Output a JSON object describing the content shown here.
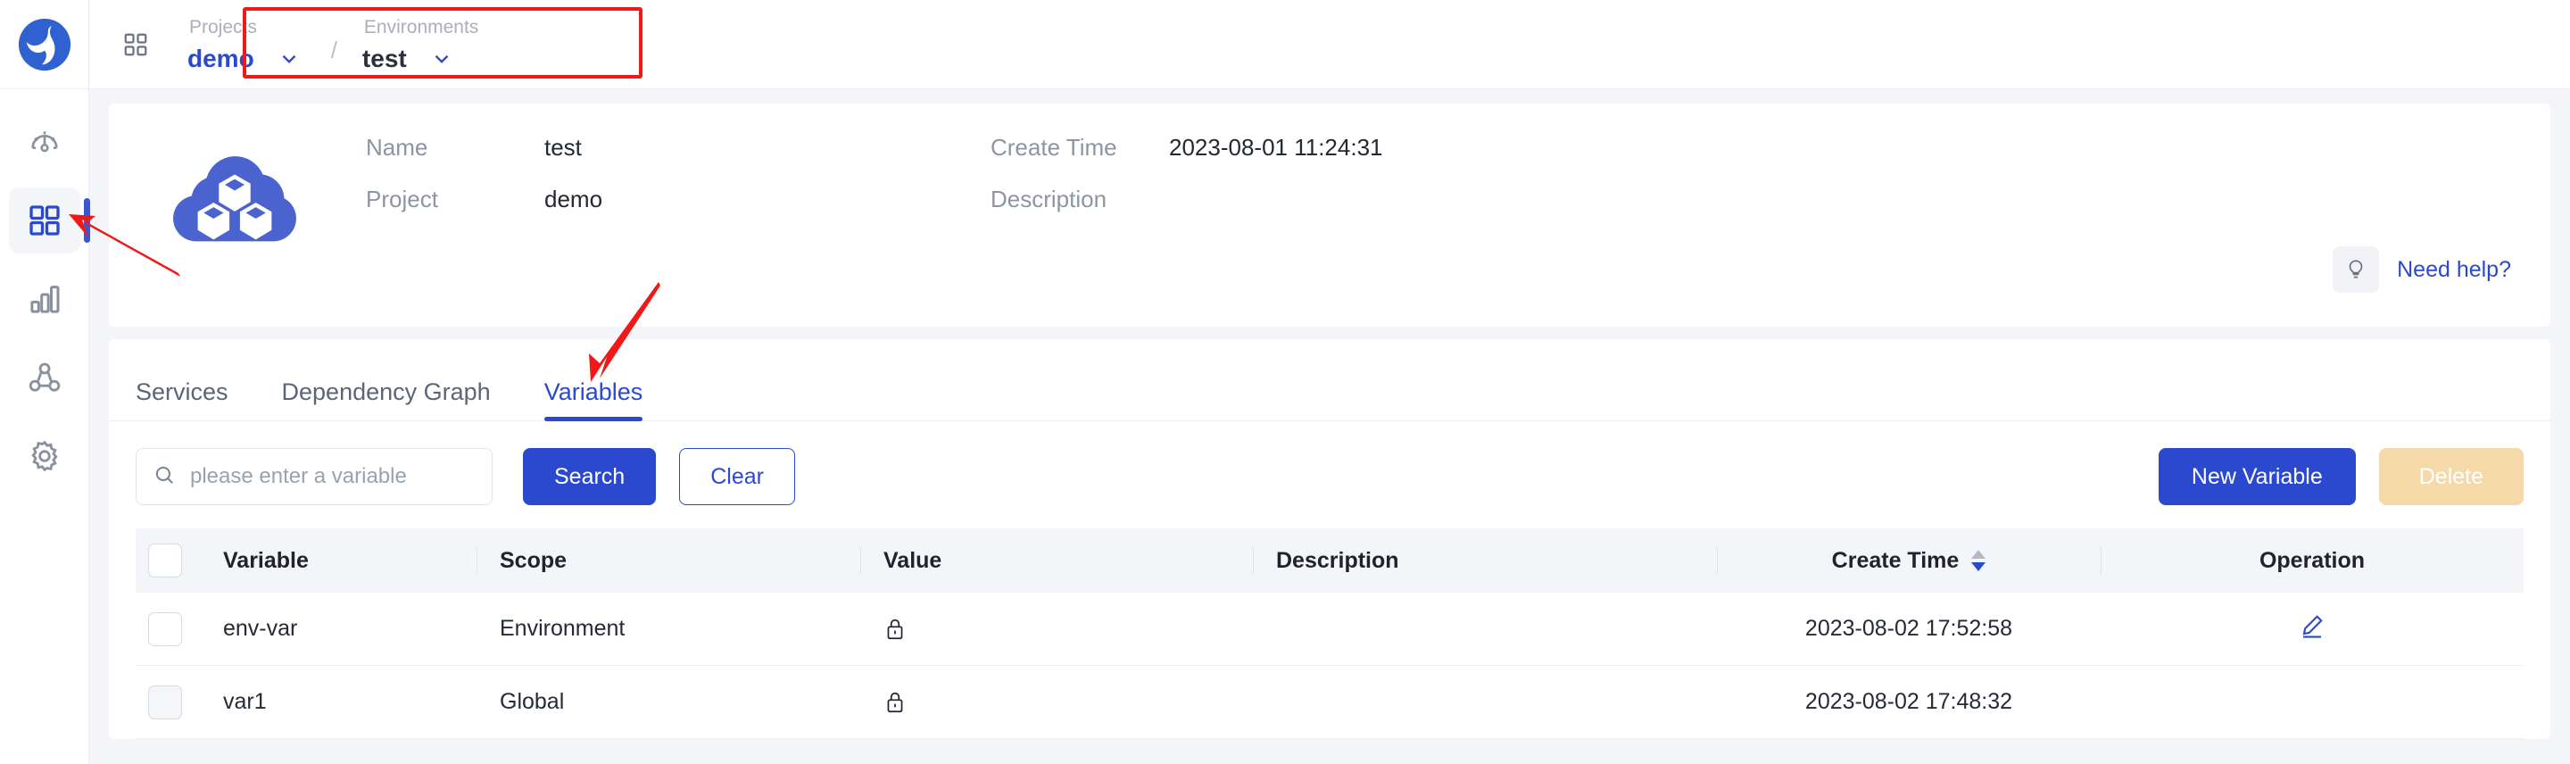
{
  "app": {
    "logo_name": "dolphinscheduler-logo",
    "apps_icon": "grid-apps-icon"
  },
  "sidebar": {
    "items": [
      {
        "name": "dashboard",
        "icon": "gauge-icon",
        "active": false
      },
      {
        "name": "projects",
        "icon": "grid-icon",
        "active": true
      },
      {
        "name": "resources",
        "icon": "bar-chart-icon",
        "active": false
      },
      {
        "name": "datasource",
        "icon": "topology-icon",
        "active": false
      },
      {
        "name": "settings",
        "icon": "gear-icon",
        "active": false
      }
    ]
  },
  "topbar": {
    "project_label": "Projects",
    "project_value": "demo",
    "separator": "/",
    "environment_label": "Environments",
    "environment_value": "test",
    "chevron_icon": "chevron-down-icon"
  },
  "info": {
    "icon": "cloud-cubes-icon",
    "name_label": "Name",
    "name_value": "test",
    "project_label": "Project",
    "project_value": "demo",
    "create_time_label": "Create Time",
    "create_time_value": "2023-08-01 11:24:31",
    "description_label": "Description",
    "description_value": "",
    "need_help_label": "Need help?",
    "need_help_icon": "lightbulb-icon"
  },
  "tabs": [
    {
      "label": "Services",
      "active": false
    },
    {
      "label": "Dependency Graph",
      "active": false
    },
    {
      "label": "Variables",
      "active": true
    }
  ],
  "toolbar": {
    "search_placeholder": "please enter a variable",
    "search_value": "",
    "search_icon": "search-icon",
    "search_label": "Search",
    "clear_label": "Clear",
    "new_variable_label": "New Variable",
    "delete_label": "Delete"
  },
  "table": {
    "columns": [
      "Variable",
      "Scope",
      "Value",
      "Description",
      "Create Time",
      "Operation"
    ],
    "sort_column": "Create Time",
    "sort_direction": "descending",
    "rows": [
      {
        "variable": "env-var",
        "scope": "Environment",
        "value_icon": "lock-icon",
        "description": "",
        "create_time": "2023-08-02 17:52:58",
        "operation_icon": "edit-pencil-icon",
        "checked": false
      },
      {
        "variable": "var1",
        "scope": "Global",
        "value_icon": "lock-icon",
        "description": "",
        "create_time": "2023-08-02 17:48:32",
        "operation_icon": "",
        "checked": false
      }
    ]
  },
  "colors": {
    "accent": "#2a49cf",
    "annotation": "#f01818",
    "delete_disabled": "#f5d9a8",
    "page_bg": "#f3f5f9"
  }
}
